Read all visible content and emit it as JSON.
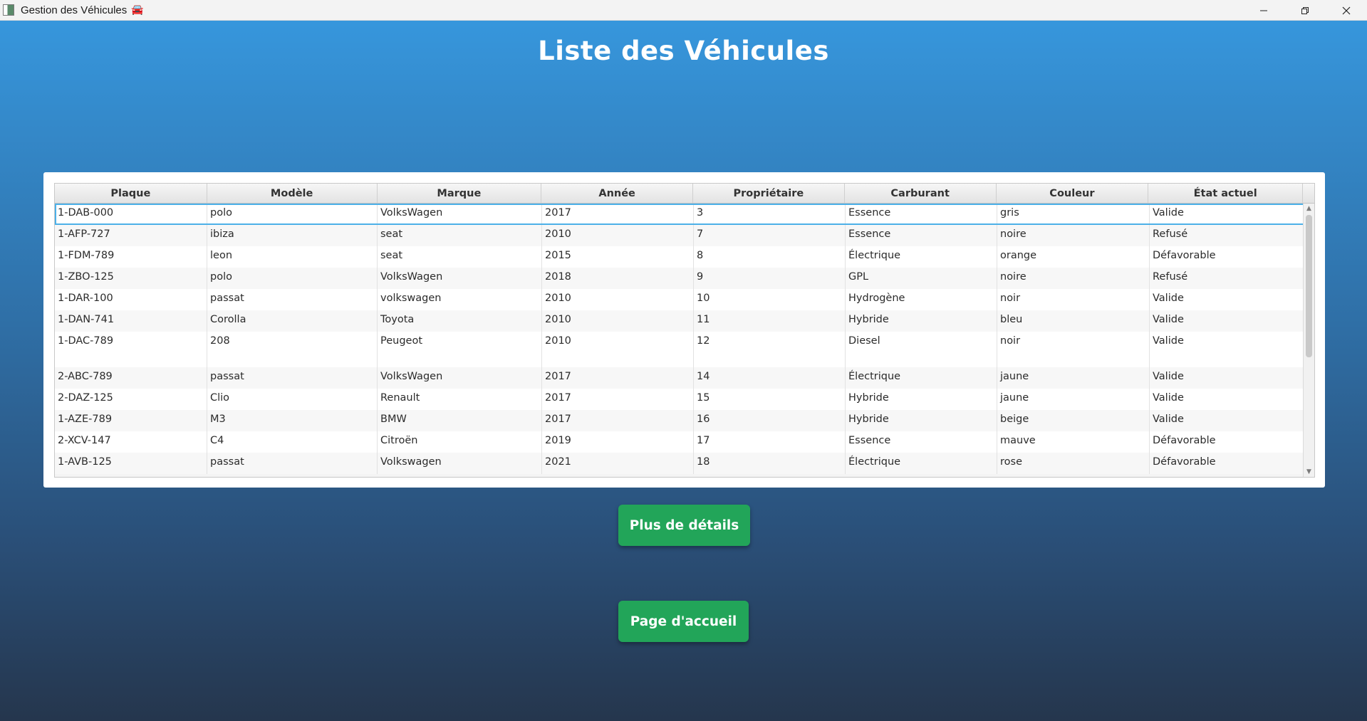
{
  "window": {
    "title": "Gestion des Véhicules",
    "title_icon": "car-icon",
    "controls": [
      "minimize-icon",
      "restore-icon",
      "close-icon"
    ]
  },
  "page": {
    "heading": "Liste des Véhicules"
  },
  "table": {
    "columns": [
      "Plaque",
      "Modèle",
      "Marque",
      "Année",
      "Propriétaire",
      "Carburant",
      "Couleur",
      "État actuel"
    ],
    "rows": [
      [
        "1-DAB-000",
        "polo",
        "VolksWagen",
        "2017",
        "3",
        "Essence",
        "gris",
        "Valide"
      ],
      [
        "1-AFP-727",
        "ibiza",
        "seat",
        "2010",
        "7",
        "Essence",
        "noire",
        "Refusé"
      ],
      [
        "1-FDM-789",
        "leon",
        "seat",
        "2015",
        "8",
        "Électrique",
        "orange",
        "Défavorable"
      ],
      [
        "1-ZBO-125",
        "polo",
        "VolksWagen",
        "2018",
        "9",
        "GPL",
        "noire",
        "Refusé"
      ],
      [
        "1-DAR-100",
        "passat",
        "volkswagen",
        "2010",
        "10",
        "Hydrogène",
        "noir",
        "Valide"
      ],
      [
        "1-DAN-741",
        "Corolla",
        "Toyota",
        "2010",
        "11",
        "Hybride",
        "bleu",
        "Valide"
      ],
      [
        "1-DAC-789",
        "208",
        "Peugeot",
        "2010",
        "12",
        "Diesel",
        "noir",
        "Valide"
      ],
      [
        "2-ABC-789",
        "passat",
        "VolksWagen",
        "2017",
        "14",
        "Électrique",
        "jaune",
        "Valide"
      ],
      [
        "2-DAZ-125",
        "Clio",
        "Renault",
        "2017",
        "15",
        "Hybride",
        "jaune",
        "Valide"
      ],
      [
        "1-AZE-789",
        "M3",
        "BMW",
        "2017",
        "16",
        "Hybride",
        "beige",
        "Valide"
      ],
      [
        "2-XCV-147",
        "C4",
        "Citroën",
        "2019",
        "17",
        "Essence",
        "mauve",
        "Défavorable"
      ],
      [
        "1-AVB-125",
        "passat",
        "Volkswagen",
        "2021",
        "18",
        "Électrique",
        "rose",
        "Défavorable"
      ]
    ],
    "selected_row": 0,
    "tall_row": 6
  },
  "buttons": {
    "details": "Plus de détails",
    "home": "Page d'accueil"
  },
  "colors": {
    "button": "#22a559",
    "selection_outline": "#4cb0e8",
    "background_top": "#3799e0",
    "background_bottom": "#25364d"
  }
}
